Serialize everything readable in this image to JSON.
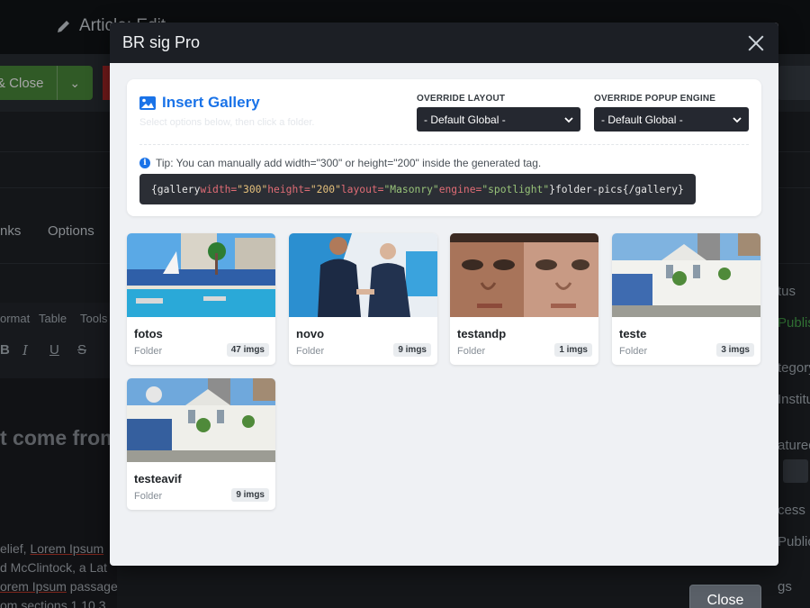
{
  "background": {
    "article_title": "Article: Edit",
    "save_close_label": "& Close",
    "tabs": [
      "nks",
      "Options"
    ],
    "editor_menu": [
      "ormat",
      "Table",
      "Tools"
    ],
    "heading_fragment": "t come from",
    "text_lines": [
      "elief, ",
      "Lorem Ipsum",
      "d McClintock, a Lat",
      "orem Ipsum",
      " passage",
      "om sections 1.10.3"
    ],
    "sidebar": [
      "tus",
      "Publis",
      "tegory",
      "Institu",
      "atured",
      "cess",
      "Public",
      "gs"
    ],
    "close_button": "Close"
  },
  "modal": {
    "title": "BR sig Pro",
    "panel": {
      "title": "Insert Gallery",
      "subtitle": "Select options below, then click a folder.",
      "override_layout_label": "OVERRIDE LAYOUT",
      "override_layout_value": "- Default Global -",
      "override_engine_label": "OVERRIDE POPUP ENGINE",
      "override_engine_value": "- Default Global -",
      "tip": "Tip: You can manually add width=\"300\" or height=\"200\" inside the generated tag.",
      "code": {
        "open": "{gallery",
        "attr1": " width=",
        "val1": "\"300\"",
        "attr2": " height=",
        "val2": "\"200\"",
        "attr3": " layout=",
        "val3": "\"Masonry\"",
        "attr4": " engine=",
        "val4": "\"spotlight\"",
        "close1": "}",
        "folder": "folder-pics",
        "close_tag": "{/gallery}"
      }
    },
    "folders": [
      {
        "name": "fotos",
        "type": "Folder",
        "count": "47 imgs"
      },
      {
        "name": "novo",
        "type": "Folder",
        "count": "9 imgs"
      },
      {
        "name": "testandp",
        "type": "Folder",
        "count": "1 imgs"
      },
      {
        "name": "teste",
        "type": "Folder",
        "count": "3 imgs"
      },
      {
        "name": "testeavif",
        "type": "Folder",
        "count": "9 imgs"
      }
    ]
  },
  "colors": {
    "accent": "#1a73e8",
    "header_bg": "#1c1f25",
    "modal_body": "#eff1f4"
  }
}
